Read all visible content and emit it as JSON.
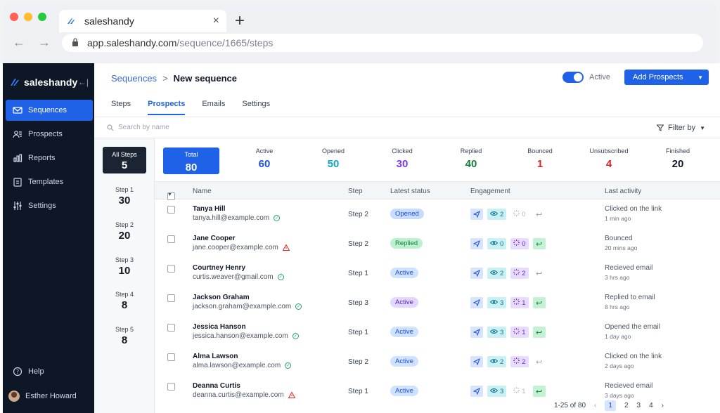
{
  "browser": {
    "tab_title": "saleshandy",
    "tab_close": "×",
    "new_tab": "+",
    "url_host": "app.saleshandy.com",
    "url_path": "/sequence/1665/steps",
    "dots": [
      "#ff5f57",
      "#febc2e",
      "#28c840"
    ]
  },
  "sidebar": {
    "brand": "saleshandy",
    "collapse": "←|",
    "items": [
      {
        "label": "Sequences",
        "icon": "mail-icon",
        "active": true
      },
      {
        "label": "Prospects",
        "icon": "users-icon"
      },
      {
        "label": "Reports",
        "icon": "bar-chart-icon"
      },
      {
        "label": "Templates",
        "icon": "clipboard-icon"
      },
      {
        "label": "Settings",
        "icon": "sliders-icon"
      }
    ],
    "help": "Help",
    "user": "Esther Howard"
  },
  "header": {
    "crumb_parent": "Sequences",
    "crumb_sep": ">",
    "crumb_current": "New sequence",
    "toggle_label": "Active",
    "add_button": "Add Prospects"
  },
  "tabs": [
    "Steps",
    "Prospects",
    "Emails",
    "Settings"
  ],
  "search": {
    "placeholder": "Search by name"
  },
  "filter": {
    "label": "Filter by"
  },
  "steps": [
    {
      "label": "All Steps",
      "value": "5"
    },
    {
      "label": "Step 1",
      "value": "30"
    },
    {
      "label": "Step 2",
      "value": "20"
    },
    {
      "label": "Step 3",
      "value": "10"
    },
    {
      "label": "Step 4",
      "value": "8"
    },
    {
      "label": "Step 5",
      "value": "8"
    }
  ],
  "stats": [
    {
      "label": "Total",
      "value": "80",
      "color": "#ffffff"
    },
    {
      "label": "Active",
      "value": "60",
      "color": "#1d4ed8"
    },
    {
      "label": "Opened",
      "value": "50",
      "color": "#0ea5c6"
    },
    {
      "label": "Clicked",
      "value": "30",
      "color": "#7c3aed"
    },
    {
      "label": "Replied",
      "value": "40",
      "color": "#15803d"
    },
    {
      "label": "Bounced",
      "value": "1",
      "color": "#dc2626"
    },
    {
      "label": "Unsubscribed",
      "value": "4",
      "color": "#dc2626"
    },
    {
      "label": "Finished",
      "value": "20",
      "color": "#111827"
    }
  ],
  "table": {
    "headers": {
      "name": "Name",
      "step": "Step",
      "status": "Latest status",
      "engagement": "Engagement",
      "activity": "Last activity"
    },
    "rows": [
      {
        "name": "Tanya Hill",
        "email": "tanya.hill@example.com",
        "verify": "ok",
        "step": "Step 2",
        "status": "Opened",
        "status_style": "opened",
        "opens": "2",
        "clicks": "0",
        "click_on": false,
        "reply_on": false,
        "activity": "Clicked on the link",
        "ago": "1 min ago"
      },
      {
        "name": "Jane Cooper",
        "email": "jane.cooper@example.com",
        "verify": "warn",
        "step": "Step 2",
        "status": "Replied",
        "status_style": "replied",
        "opens": "0",
        "clicks": "0",
        "click_on": true,
        "reply_on": true,
        "activity": "Bounced",
        "ago": "20 mins ago"
      },
      {
        "name": "Courtney Henry",
        "email": "curtis.weaver@gmail.com",
        "verify": "ok",
        "step": "Step 1",
        "status": "Active",
        "status_style": "active",
        "opens": "2",
        "clicks": "2",
        "click_on": true,
        "reply_on": false,
        "activity": "Recieved email",
        "ago": "3 hrs ago"
      },
      {
        "name": "Jackson Graham",
        "email": "jackson.graham@example.com",
        "verify": "ok",
        "step": "Step 3",
        "status": "Active",
        "status_style": "active2",
        "opens": "3",
        "clicks": "1",
        "click_on": true,
        "reply_on": true,
        "activity": "Replied to email",
        "ago": "8 hrs ago"
      },
      {
        "name": "Jessica Hanson",
        "email": "jessica.hanson@example.com",
        "verify": "ok",
        "step": "Step 1",
        "status": "Active",
        "status_style": "active",
        "opens": "3",
        "clicks": "1",
        "click_on": true,
        "reply_on": true,
        "activity": "Opened the email",
        "ago": "1 day ago"
      },
      {
        "name": "Alma Lawson",
        "email": "alma.lawson@example.com",
        "verify": "ok",
        "step": "Step 2",
        "status": "Active",
        "status_style": "active",
        "opens": "2",
        "clicks": "2",
        "click_on": true,
        "reply_on": false,
        "activity": "Clicked on the link",
        "ago": "2 days ago"
      },
      {
        "name": "Deanna Curtis",
        "email": "deanna.curtis@example.com",
        "verify": "warn",
        "step": "Step 1",
        "status": "Active",
        "status_style": "active",
        "opens": "3",
        "clicks": "1",
        "click_on": false,
        "reply_on": true,
        "activity": "Recieved email",
        "ago": "3 days ago"
      }
    ]
  },
  "pager": {
    "range": "1-25 of 80",
    "pages": [
      "1",
      "2",
      "3",
      "4"
    ],
    "current": "1"
  }
}
